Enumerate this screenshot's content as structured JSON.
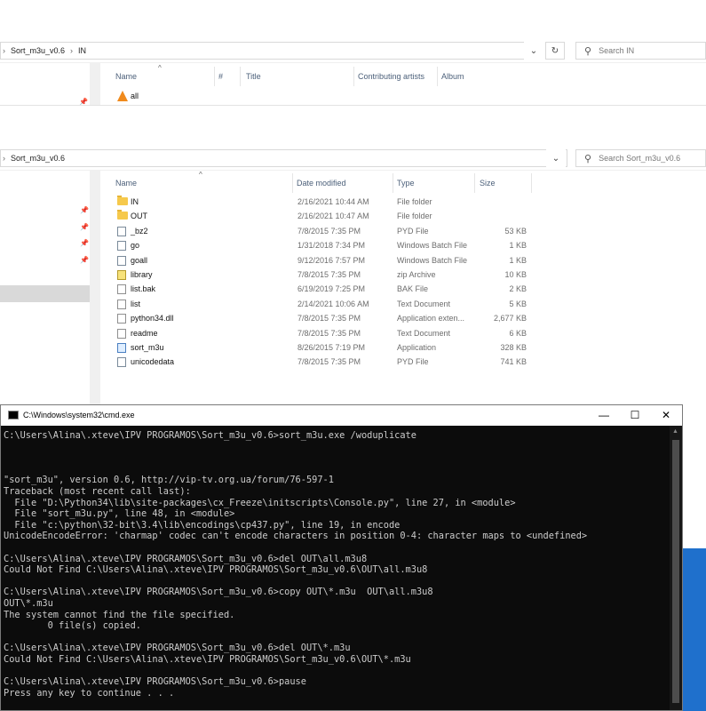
{
  "win_in": {
    "breadcrumb": [
      "Sort_m3u_v0.6",
      "IN"
    ],
    "search_placeholder": "Search IN",
    "columns": [
      "Name",
      "#",
      "Title",
      "Contributing artists",
      "Album"
    ],
    "files": [
      {
        "name": "all"
      }
    ]
  },
  "win_main": {
    "breadcrumb": [
      "Sort_m3u_v0.6"
    ],
    "search_placeholder": "Search Sort_m3u_v0.6",
    "columns": [
      "Name",
      "Date modified",
      "Type",
      "Size"
    ],
    "files": [
      {
        "name": "IN",
        "date": "2/16/2021 10:44 AM",
        "type": "File folder",
        "size": "",
        "icon": "folder-icon"
      },
      {
        "name": "OUT",
        "date": "2/16/2021 10:47 AM",
        "type": "File folder",
        "size": "",
        "icon": "folder-icon"
      },
      {
        "name": "_bz2",
        "date": "7/8/2015 7:35 PM",
        "type": "PYD File",
        "size": "53 KB",
        "icon": "gear-file-icon"
      },
      {
        "name": "go",
        "date": "1/31/2018 7:34 PM",
        "type": "Windows Batch File",
        "size": "1 KB",
        "icon": "gear-file-icon"
      },
      {
        "name": "goall",
        "date": "9/12/2016 7:57 PM",
        "type": "Windows Batch File",
        "size": "1 KB",
        "icon": "gear-file-icon"
      },
      {
        "name": "library",
        "date": "7/8/2015 7:35 PM",
        "type": "zip Archive",
        "size": "10 KB",
        "icon": "zip-file-icon"
      },
      {
        "name": "list.bak",
        "date": "6/19/2019 7:25 PM",
        "type": "BAK File",
        "size": "2 KB",
        "icon": "file-icon"
      },
      {
        "name": "list",
        "date": "2/14/2021 10:06 AM",
        "type": "Text Document",
        "size": "5 KB",
        "icon": "text-file-icon"
      },
      {
        "name": "python34.dll",
        "date": "7/8/2015 7:35 PM",
        "type": "Application exten...",
        "size": "2,677 KB",
        "icon": "dll-file-icon"
      },
      {
        "name": "readme",
        "date": "7/8/2015 7:35 PM",
        "type": "Text Document",
        "size": "6 KB",
        "icon": "text-file-icon"
      },
      {
        "name": "sort_m3u",
        "date": "8/26/2015 7:19 PM",
        "type": "Application",
        "size": "328 KB",
        "icon": "app-icon"
      },
      {
        "name": "unicodedata",
        "date": "7/8/2015 7:35 PM",
        "type": "PYD File",
        "size": "741 KB",
        "icon": "gear-file-icon"
      }
    ]
  },
  "cmd": {
    "title": "C:\\Windows\\system32\\cmd.exe",
    "minimize": "—",
    "maximize": "☐",
    "close": "✕",
    "lines": [
      "C:\\Users\\Alina\\.xteve\\IPV PROGRAMOS\\Sort_m3u_v0.6>sort_m3u.exe /woduplicate",
      "",
      "",
      "",
      "\"sort_m3u\", version 0.6, http://vip-tv.org.ua/forum/76-597-1",
      "Traceback (most recent call last):",
      "  File \"D:\\Python34\\lib\\site-packages\\cx_Freeze\\initscripts\\Console.py\", line 27, in <module>",
      "  File \"sort_m3u.py\", line 48, in <module>",
      "  File \"c:\\python\\32-bit\\3.4\\lib\\encodings\\cp437.py\", line 19, in encode",
      "UnicodeEncodeError: 'charmap' codec can't encode characters in position 0-4: character maps to <undefined>",
      "",
      "C:\\Users\\Alina\\.xteve\\IPV PROGRAMOS\\Sort_m3u_v0.6>del OUT\\all.m3u8",
      "Could Not Find C:\\Users\\Alina\\.xteve\\IPV PROGRAMOS\\Sort_m3u_v0.6\\OUT\\all.m3u8",
      "",
      "C:\\Users\\Alina\\.xteve\\IPV PROGRAMOS\\Sort_m3u_v0.6>copy OUT\\*.m3u  OUT\\all.m3u8",
      "OUT\\*.m3u",
      "The system cannot find the file specified.",
      "        0 file(s) copied.",
      "",
      "C:\\Users\\Alina\\.xteve\\IPV PROGRAMOS\\Sort_m3u_v0.6>del OUT\\*.m3u",
      "Could Not Find C:\\Users\\Alina\\.xteve\\IPV PROGRAMOS\\Sort_m3u_v0.6\\OUT\\*.m3u",
      "",
      "C:\\Users\\Alina\\.xteve\\IPV PROGRAMOS\\Sort_m3u_v0.6>pause",
      "Press any key to continue . . ."
    ]
  }
}
